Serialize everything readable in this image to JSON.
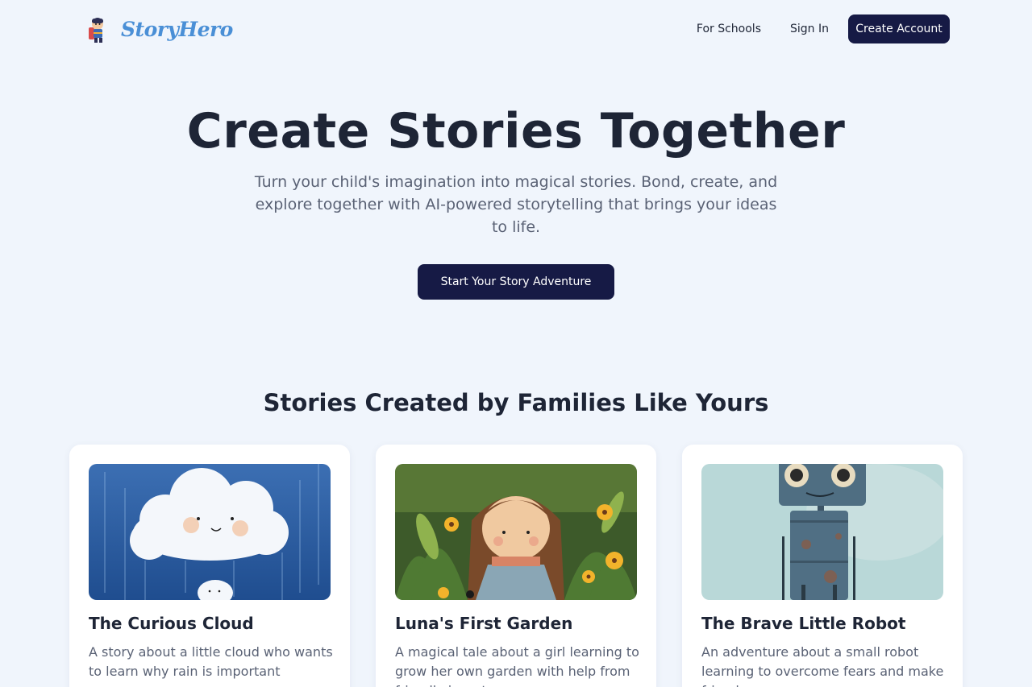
{
  "brand": {
    "name": "StoryHero",
    "logo_icon": "hero-character-icon"
  },
  "nav": {
    "for_schools": "For Schools",
    "sign_in": "Sign In",
    "create_account": "Create Account"
  },
  "hero": {
    "title": "Create Stories Together",
    "subtitle": "Turn your child's imagination into magical stories. Bond, create, and explore together with AI-powered storytelling that brings your ideas to life.",
    "cta": "Start Your Story Adventure"
  },
  "stories": {
    "title": "Stories Created by Families Like Yours",
    "items": [
      {
        "title": "The Curious Cloud",
        "description": "A story about a little cloud who wants to learn why rain is important"
      },
      {
        "title": "Luna's First Garden",
        "description": "A magical tale about a girl learning to grow her own garden with help from friendly insects"
      },
      {
        "title": "The Brave Little Robot",
        "description": "An adventure about a small robot learning to overcome fears and make friends"
      }
    ]
  },
  "colors": {
    "background": "#f0f5fc",
    "primary": "#161a45",
    "brand": "#4a8fd6",
    "text": "#1e2536",
    "muted": "#5a6275"
  }
}
